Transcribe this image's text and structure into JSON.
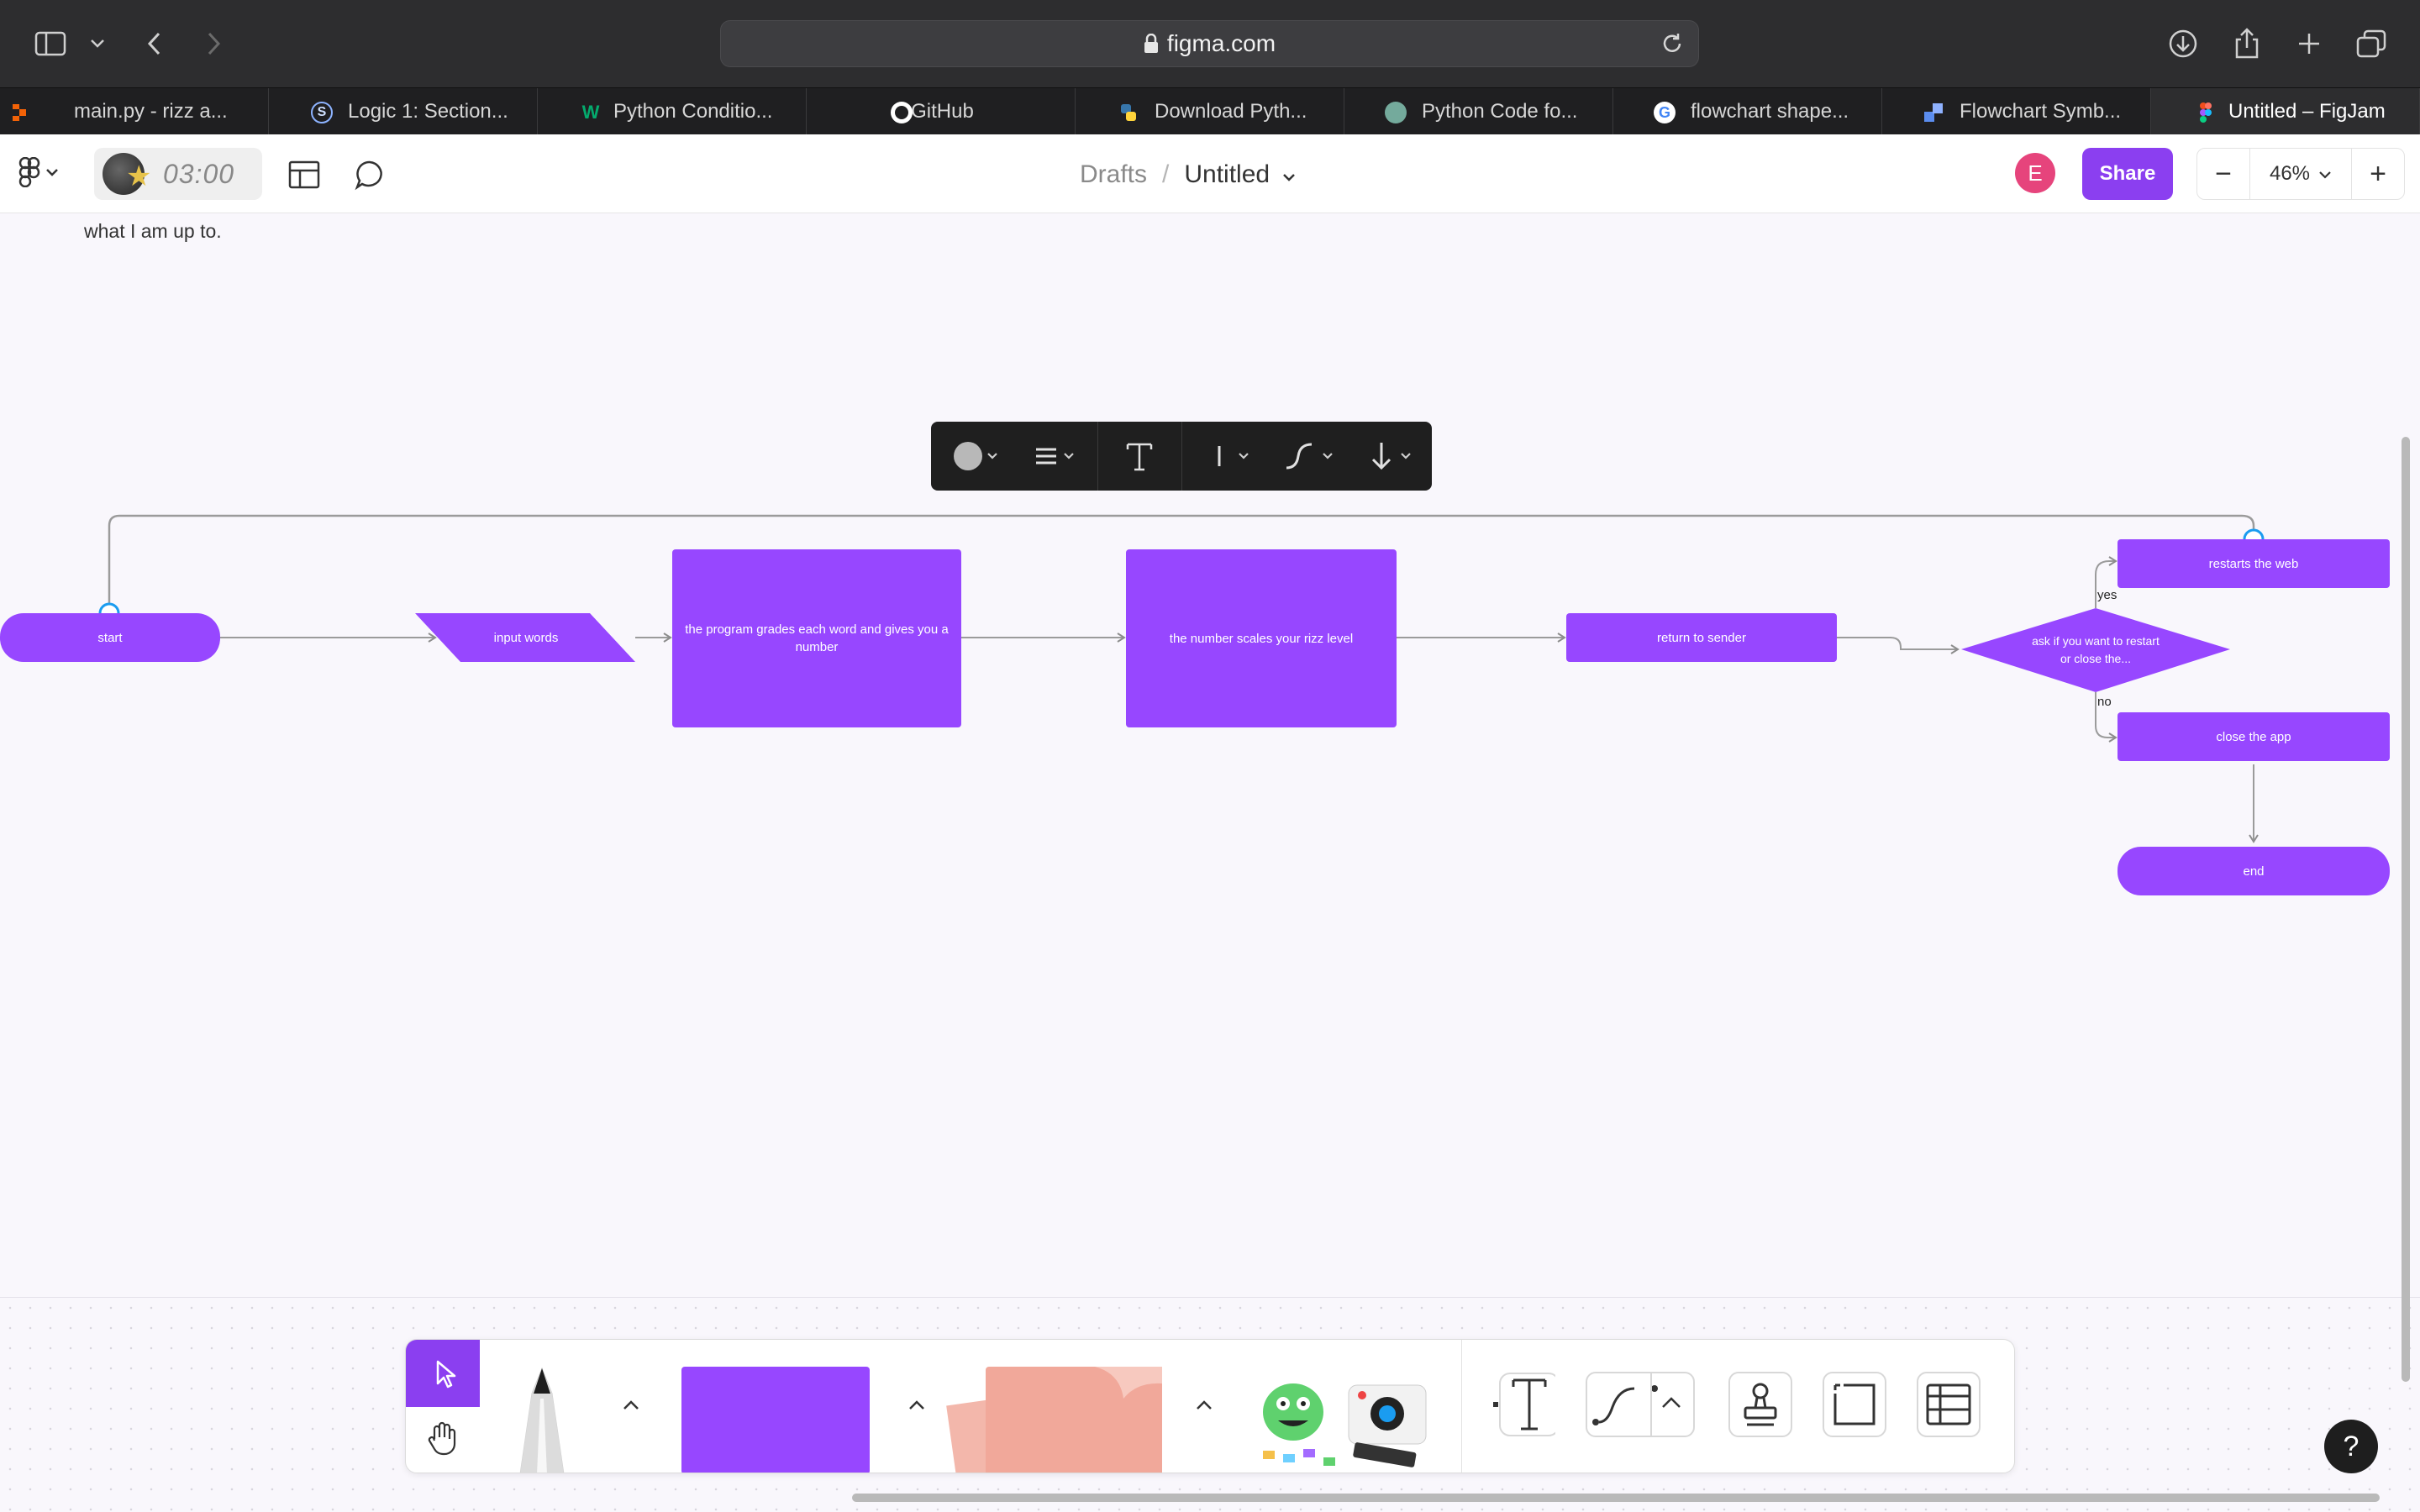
{
  "browser": {
    "url": "figma.com",
    "tabs": [
      {
        "label": "main.py - rizz a...",
        "icon": "replit-icon",
        "color": "#f26207"
      },
      {
        "label": "Logic 1: Section...",
        "icon": "s-circle-icon",
        "color": "#3d6eb5"
      },
      {
        "label": "Python Conditio...",
        "icon": "w3schools-icon",
        "color": "#04aa6d"
      },
      {
        "label": "GitHub",
        "icon": "github-icon",
        "color": "#ffffff"
      },
      {
        "label": "Download Pyth...",
        "icon": "python-icon",
        "color": "#3776ab"
      },
      {
        "label": "Python Code fo...",
        "icon": "chatgpt-icon",
        "color": "#74aa9c"
      },
      {
        "label": "flowchart shape...",
        "icon": "google-icon",
        "color": "#4285f4"
      },
      {
        "label": "Flowchart Symb...",
        "icon": "lucid-icon",
        "color": "#5b8def"
      },
      {
        "label": "Untitled – FigJam",
        "icon": "figma-icon",
        "color": "#f24e1e"
      }
    ]
  },
  "toolbar": {
    "timer": "03:00",
    "breadcrumb_root": "Drafts",
    "breadcrumb_sep": "/",
    "file_title": "Untitled",
    "avatar_initial": "E",
    "share_label": "Share",
    "zoom_minus": "−",
    "zoom_value": "46%",
    "zoom_plus": "+"
  },
  "canvas": {
    "partial_text": "what I am up to.",
    "nodes": {
      "start": "start",
      "input": "input words",
      "grade": "the program grades each word and gives you a number",
      "scale": "the number scales your rizz level",
      "return": "return to sender",
      "ask": "ask if you want to restart or close the...",
      "restart": "restarts the web",
      "close": "close the app",
      "end": "end"
    },
    "edge_labels": {
      "yes": "yes",
      "no": "no"
    }
  },
  "help_label": "?",
  "colors": {
    "accent": "#9747ff",
    "share": "#8b3ff0",
    "avatar": "#e6447c"
  }
}
